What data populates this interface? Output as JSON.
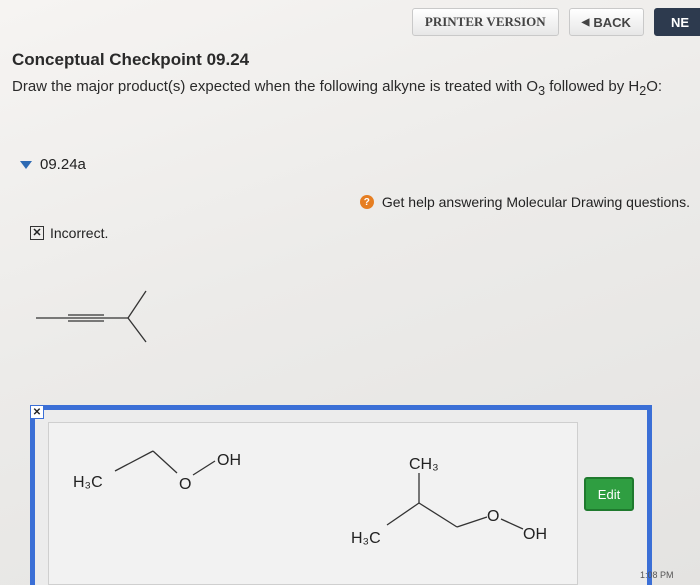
{
  "toolbar": {
    "printer_label": "PRINTER VERSION",
    "back_label": "BACK",
    "next_label": "NE"
  },
  "question": {
    "title": "Conceptual Checkpoint 09.24",
    "prompt_before": "Draw the major product(s) expected when the following alkyne is treated with O",
    "prompt_sub": "3",
    "prompt_after": " followed by H",
    "prompt_sub2": "2",
    "prompt_end": "O:"
  },
  "part": {
    "label": "09.24a"
  },
  "help": {
    "icon": "question-icon",
    "text": "Get help answering Molecular Drawing questions."
  },
  "status": {
    "icon": "x-icon",
    "text": "Incorrect."
  },
  "answer": {
    "edit_label": "Edit",
    "molecule1": {
      "left_group": "H₃C",
      "oxygen": "O",
      "right_group": "OH"
    },
    "molecule2": {
      "top_group": "CH₃",
      "left_group": "H₃C",
      "oxygen": "O",
      "right_group": "OH"
    }
  },
  "system": {
    "clock": "1:08 PM"
  }
}
